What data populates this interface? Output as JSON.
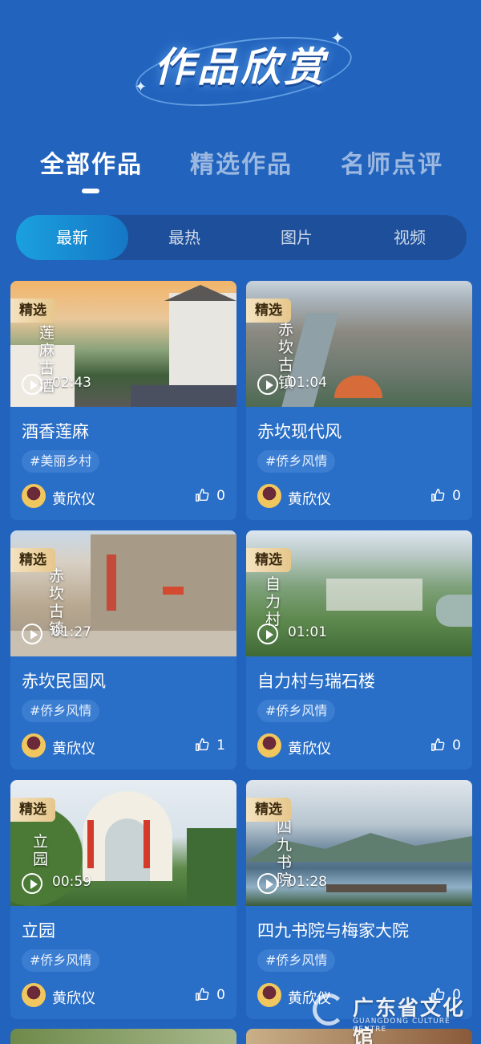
{
  "header": {
    "title": "作品欣赏"
  },
  "main_tabs": [
    {
      "label": "全部作品",
      "active": true
    },
    {
      "label": "精选作品",
      "active": false
    },
    {
      "label": "名师点评",
      "active": false
    }
  ],
  "sub_tabs": [
    {
      "label": "最新",
      "active": true
    },
    {
      "label": "最热",
      "active": false
    },
    {
      "label": "图片",
      "active": false
    },
    {
      "label": "视频",
      "active": false
    }
  ],
  "cards": [
    {
      "badge": "精选",
      "duration": "02:43",
      "overlay_text": "莲麻古酒",
      "title": "酒香莲麻",
      "tag": "#美丽乡村",
      "author": "黄欣仪",
      "likes": "0"
    },
    {
      "badge": "精选",
      "duration": "01:04",
      "overlay_text": "赤坎古镇",
      "title": "赤坎现代风",
      "tag": "#侨乡风情",
      "author": "黄欣仪",
      "likes": "0"
    },
    {
      "badge": "精选",
      "duration": "01:27",
      "overlay_text": "赤坎古镇",
      "title": "赤坎民国风",
      "tag": "#侨乡风情",
      "author": "黄欣仪",
      "likes": "1"
    },
    {
      "badge": "精选",
      "duration": "01:01",
      "overlay_text": "自力村",
      "title": "自力村与瑞石楼",
      "tag": "#侨乡风情",
      "author": "黄欣仪",
      "likes": "0"
    },
    {
      "badge": "精选",
      "duration": "00:59",
      "overlay_text": "立园",
      "title": "立园",
      "tag": "#侨乡风情",
      "author": "黄欣仪",
      "likes": "0"
    },
    {
      "badge": "精选",
      "duration": "01:28",
      "overlay_text": "四九书院",
      "title": "四九书院与梅家大院",
      "tag": "#侨乡风情",
      "author": "黄欣仪",
      "likes": "0"
    }
  ],
  "watermark": {
    "name": "广东省文化馆",
    "sub": "GUANGDONG CULTURE CENTRE"
  },
  "colors": {
    "background": "#2263bd",
    "card": "#2a6fc7",
    "badge": "#e6c78c",
    "active_subtab": "#1aa0de"
  }
}
